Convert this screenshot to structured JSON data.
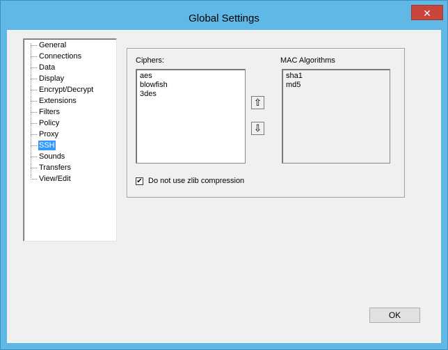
{
  "window": {
    "title": "Global Settings",
    "close_glyph": "✕"
  },
  "tree": {
    "items": [
      {
        "label": "General"
      },
      {
        "label": "Connections"
      },
      {
        "label": "Data"
      },
      {
        "label": "Display"
      },
      {
        "label": "Encrypt/Decrypt"
      },
      {
        "label": "Extensions"
      },
      {
        "label": "Filters"
      },
      {
        "label": "Policy"
      },
      {
        "label": "Proxy"
      },
      {
        "label": "SSH"
      },
      {
        "label": "Sounds"
      },
      {
        "label": "Transfers"
      },
      {
        "label": "View/Edit"
      }
    ],
    "selected": "SSH"
  },
  "ssh": {
    "ciphers_label": "Ciphers:",
    "ciphers": [
      "aes",
      "blowfish",
      "3des"
    ],
    "mac_label": "MAC Algorithms",
    "mac": [
      "sha1",
      "md5"
    ],
    "move_up_glyph": "⇧",
    "move_down_glyph": "⇩",
    "zlib_label": "Do not use zlib compression",
    "zlib_checked": true,
    "check_glyph": "✔"
  },
  "footer": {
    "ok_label": "OK"
  }
}
